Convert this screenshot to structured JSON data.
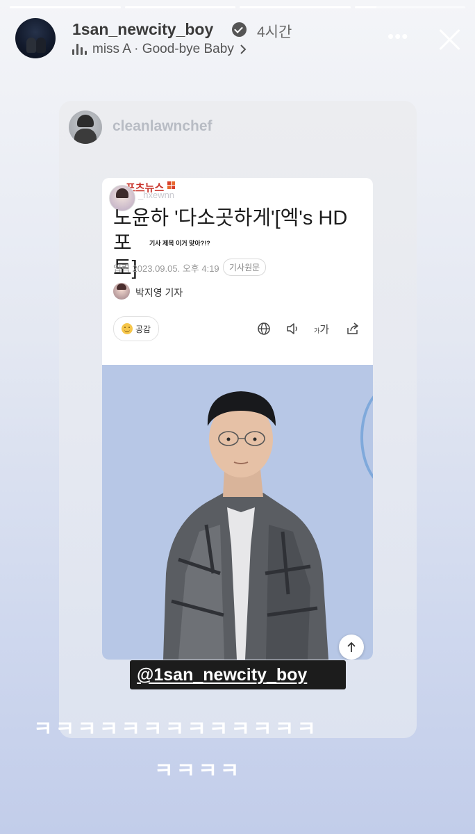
{
  "story": {
    "progress_segments": [
      1.0,
      1.0,
      1.0,
      0.2
    ],
    "username": "1san_newcity_boy",
    "time_ago": "4시간",
    "music": "miss A · Good-bye Baby"
  },
  "repost": {
    "username": "cleanlawnchef"
  },
  "article": {
    "outlet_logo": "포츠뉴스",
    "sharer": "_hxewnn",
    "headline": "노윤하 '다소곳하게'[엑's HD포토]",
    "headline_line1": "노윤하 '다소곳하게'[엑's HD포",
    "headline_line2": "토]",
    "annotation": "기사 제목 이거 맞아?!?",
    "date": "입력 2023.09.05. 오후 4:19",
    "original_button": "기사원문",
    "reporter": "박지영 기자",
    "like_label": "공감",
    "text_size_small": "가",
    "text_size_large": "가"
  },
  "mention": "@1san_newcity_boy",
  "caption": {
    "line1": "ㅋㅋㅋㅋㅋㅋㅋㅋㅋㅋㅋㅋㅋ",
    "line2": "ㅋㅋㅋㅋ"
  },
  "colors": {
    "background_top": "#f4f5f8",
    "background_bottom": "#c2cdea",
    "mention_bg": "#1c1c1c",
    "photo_bg": "#b7c7e6",
    "logo_red": "#c8342b"
  },
  "icons": [
    "verified-icon",
    "equalizer-icon",
    "more-icon",
    "close-icon",
    "globe-icon",
    "speaker-icon",
    "text-size-icon",
    "share-icon",
    "arrow-up-icon",
    "smile-icon"
  ]
}
